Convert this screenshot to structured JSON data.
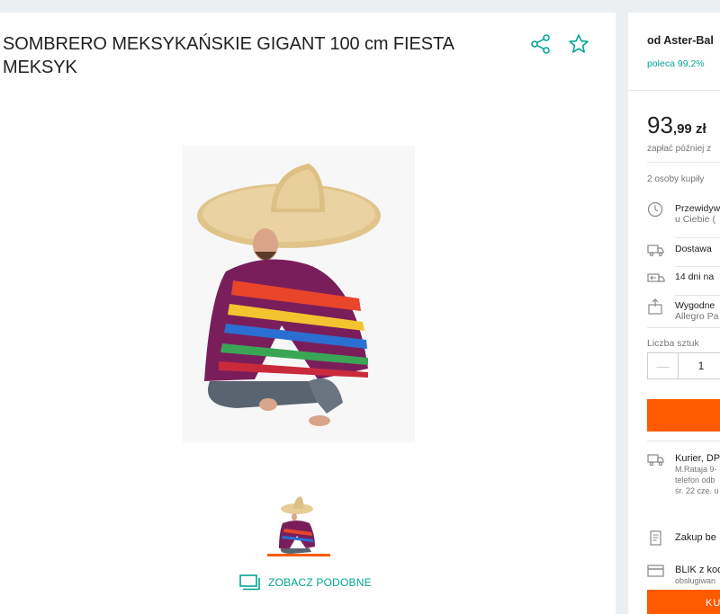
{
  "product": {
    "title": "SOMBRERO MEKSYKAŃSKIE GIGANT 100 cm FIESTA MEKSYK",
    "similar_label": "ZOBACZ PODOBNE"
  },
  "icons": {
    "share": "share-icon",
    "favorite": "star-outline-icon",
    "similar": "monitor-icon"
  },
  "colors": {
    "accent_teal": "#00a790",
    "accent_orange": "#ff5a00",
    "background": "#eceff1"
  },
  "sidebar": {
    "seller_name": "od Aster-Bal",
    "seller_recommend": "poleca 99,2%",
    "price_int": "93",
    "price_frac": ",99 zł",
    "pay_later": "zapłać później z",
    "bought_count": "2 osoby kupiły",
    "features": [
      {
        "icon": "clock-icon",
        "line1": "Przewidyw",
        "line2": "u Ciebie ("
      },
      {
        "icon": "truck-icon",
        "line1": "Dostawa",
        "line2": ""
      },
      {
        "icon": "return-icon",
        "line1": "14 dni na",
        "line2": ""
      },
      {
        "icon": "package-icon",
        "line1": "Wygodne",
        "line2": "Allegro Pa"
      }
    ],
    "quantity_label": "Liczba sztuk",
    "quantity_minus": "—",
    "quantity_value": "1",
    "delivery": [
      {
        "icon": "truck-icon",
        "title": "Kurier, DP",
        "details": [
          "M.Rataja 9-",
          "telefon odb",
          "śr. 22 cze. u"
        ]
      },
      {
        "icon": "document-icon",
        "title": "Zakup be",
        "details": []
      },
      {
        "icon": "card-icon",
        "title": "BLIK z kod",
        "details": [
          "obsługiwan"
        ]
      }
    ],
    "cart_button": "KU"
  }
}
